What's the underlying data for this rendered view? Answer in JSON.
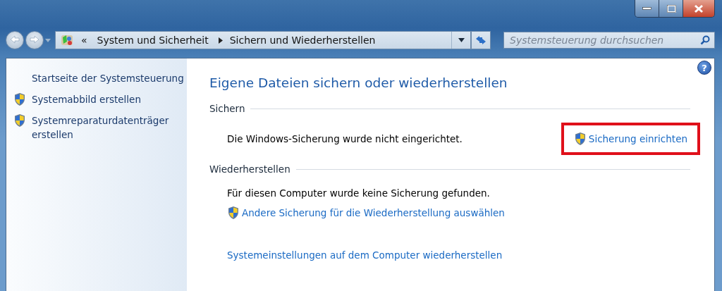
{
  "window_controls": [
    {
      "kind": "minimize"
    },
    {
      "kind": "maximize"
    },
    {
      "kind": "close"
    }
  ],
  "address_bar": {
    "overflow": "«",
    "crumbs": [
      "System und Sicherheit",
      "Sichern und Wiederherstellen"
    ]
  },
  "search": {
    "placeholder": "Systemsteuerung durchsuchen"
  },
  "help": "?",
  "sidebar": {
    "items": [
      {
        "label": "Startseite der Systemsteuerung",
        "shield": false
      },
      {
        "label": "Systemabbild erstellen",
        "shield": true
      },
      {
        "label": "Systemreparaturdatenträger erstellen",
        "shield": true
      }
    ]
  },
  "main": {
    "title": "Eigene Dateien sichern oder wiederherstellen",
    "sections": [
      {
        "heading": "Sichern",
        "rows": [
          {
            "kind": "text",
            "text": "Die Windows-Sicherung wurde nicht eingerichtet.",
            "action": {
              "label": "Sicherung einrichten",
              "shield": true,
              "highlighted": true
            }
          }
        ]
      },
      {
        "heading": "Wiederherstellen",
        "rows": [
          {
            "kind": "text",
            "text": "Für diesen Computer wurde keine Sicherung gefunden."
          },
          {
            "kind": "link",
            "label": "Andere Sicherung für die Wiederherstellung auswählen",
            "shield": true
          }
        ]
      }
    ],
    "footer_links": [
      {
        "label": "Systemeinstellungen auf dem Computer wiederherstellen",
        "shield": false
      }
    ]
  }
}
